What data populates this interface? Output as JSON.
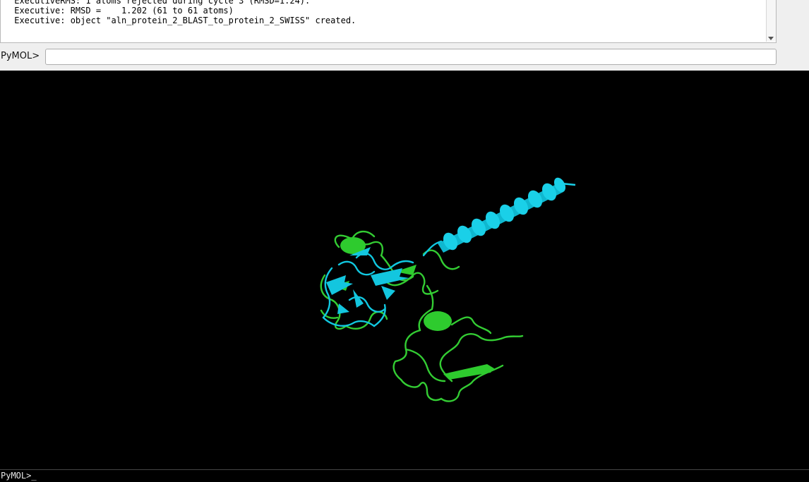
{
  "log": {
    "lines": [
      " ExecutiveRMS: 1 atoms rejected during cycle 3 (RMSD=1.24).",
      " Executive: RMSD =    1.202 (61 to 61 atoms)",
      " Executive: object \"aln_protein_2_BLAST_to_protein_2_SWISS\" created."
    ]
  },
  "command": {
    "prompt_label": "PyMOL>",
    "value": ""
  },
  "viewer": {
    "structures": [
      {
        "name": "protein_2_BLAST",
        "color": "#33cc33"
      },
      {
        "name": "protein_2_SWISS",
        "color": "#11c8e0"
      }
    ],
    "background": "#000000"
  },
  "bottom": {
    "prompt": "PyMOL>_"
  }
}
